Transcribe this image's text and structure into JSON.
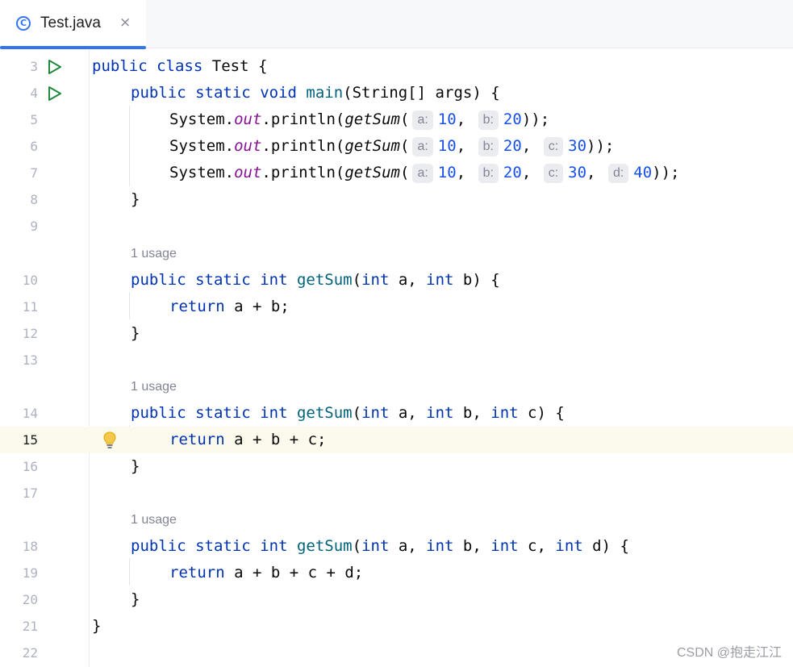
{
  "tab": {
    "title": "Test.java",
    "icon": "class-icon",
    "close": "×",
    "accent": "#3574f0"
  },
  "lines": {
    "l3": {
      "num": "3",
      "code": [
        "public",
        "class",
        "Test {"
      ]
    },
    "l4": {
      "num": "4",
      "code": [
        "public",
        "static",
        "void",
        "main",
        "(String[] args) {"
      ]
    },
    "l5": {
      "num": "5",
      "sys": "System.",
      "out": "out",
      "print": ".println(",
      "call": "getSum",
      "paren": "(",
      "args": [
        [
          "a:",
          "10"
        ],
        [
          "b:",
          "20"
        ]
      ],
      "end": "));"
    },
    "l6": {
      "num": "6",
      "sys": "System.",
      "out": "out",
      "print": ".println(",
      "call": "getSum",
      "paren": "(",
      "args": [
        [
          "a:",
          "10"
        ],
        [
          "b:",
          "20"
        ],
        [
          "c:",
          "30"
        ]
      ],
      "end": "));"
    },
    "l7": {
      "num": "7",
      "sys": "System.",
      "out": "out",
      "print": ".println(",
      "call": "getSum",
      "paren": "(",
      "args": [
        [
          "a:",
          "10"
        ],
        [
          "b:",
          "20"
        ],
        [
          "c:",
          "30"
        ],
        [
          "d:",
          "40"
        ]
      ],
      "end": "));"
    },
    "l8": {
      "num": "8",
      "text": "}"
    },
    "l9": {
      "num": "9"
    },
    "l10": {
      "num": "10"
    },
    "l11": {
      "num": "11",
      "kw": "return",
      "rest": " a + b;"
    },
    "l12": {
      "num": "12",
      "text": "}"
    },
    "l13": {
      "num": "13"
    },
    "l14": {
      "num": "14"
    },
    "l15": {
      "num": "15",
      "kw": "return",
      "rest": " a + b + c;"
    },
    "l16": {
      "num": "16",
      "text": "}"
    },
    "l17": {
      "num": "17"
    },
    "l18": {
      "num": "18"
    },
    "l19": {
      "num": "19",
      "kw": "return",
      "rest": " a + b + c + d;"
    },
    "l20": {
      "num": "20",
      "text": "}"
    },
    "l21": {
      "num": "21",
      "text": "}"
    },
    "l22": {
      "num": "22"
    }
  },
  "usage_label": "1 usage",
  "method": {
    "public": "public",
    "static": "static",
    "int": "int",
    "name": "getSum",
    "open": "(",
    "a": " a, ",
    "b": " b",
    "c": " c",
    "d": " d",
    "sep": ", ",
    "close": ") {"
  },
  "watermark": "CSDN @抱走江江"
}
